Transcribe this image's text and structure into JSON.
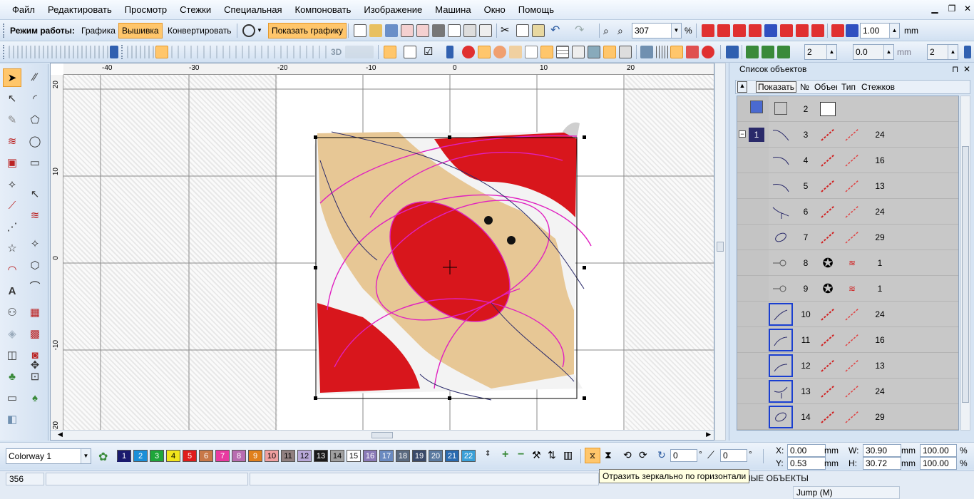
{
  "menu": [
    "Файл",
    "Редактировать",
    "Просмотр",
    "Стежки",
    "Специальная",
    "Компоновать",
    "Изображение",
    "Машина",
    "Окно",
    "Помощь"
  ],
  "toolbar1": {
    "mode_label": "Режим работы:",
    "mode_graphics": "Графика",
    "mode_embroidery": "Вышивка",
    "mode_convert": "Конвертировать",
    "show_graphics": "Показать графику",
    "zoom_value": "307",
    "zoom_unit": "%",
    "width_value": "1.00",
    "width_unit": "mm"
  },
  "toolbar2": {
    "label_3d": "3D",
    "field_a": "2",
    "field_b": "0.0",
    "field_b_unit": "mm",
    "field_c": "2"
  },
  "ruler": {
    "top_ticks": [
      "-40",
      "-30",
      "-20",
      "-10",
      "0",
      "10",
      "20"
    ],
    "left_ticks": [
      "20",
      "10",
      "0",
      "-10",
      "-20"
    ]
  },
  "object_panel": {
    "title": "Список объектов",
    "pin": "⊓",
    "close": "✕",
    "show_button": "Показать",
    "col_no": "№",
    "col_object": "Объект",
    "col_type": "Тип",
    "col_stitches": "Стежков",
    "group_number": "1",
    "rows": [
      {
        "no": "2",
        "stitches": ""
      },
      {
        "no": "3",
        "stitches": "24"
      },
      {
        "no": "4",
        "stitches": "16"
      },
      {
        "no": "5",
        "stitches": "13"
      },
      {
        "no": "6",
        "stitches": "24"
      },
      {
        "no": "7",
        "stitches": "29"
      },
      {
        "no": "8",
        "stitches": "1"
      },
      {
        "no": "9",
        "stitches": "1"
      },
      {
        "no": "10",
        "stitches": "24"
      },
      {
        "no": "11",
        "stitches": "16"
      },
      {
        "no": "12",
        "stitches": "13"
      },
      {
        "no": "13",
        "stitches": "24"
      },
      {
        "no": "14",
        "stitches": "29"
      }
    ]
  },
  "colorbar": {
    "colorway": "Colorway 1",
    "swatches": [
      {
        "n": "1",
        "color": "#1a1a6e",
        "fg": "#ffffff"
      },
      {
        "n": "2",
        "color": "#1a8fd8",
        "fg": "#ffffff"
      },
      {
        "n": "3",
        "color": "#1ea63a",
        "fg": "#ffffff"
      },
      {
        "n": "4",
        "color": "#f2e41c",
        "fg": "#000000"
      },
      {
        "n": "5",
        "color": "#e01c1c",
        "fg": "#ffffff"
      },
      {
        "n": "6",
        "color": "#c87848",
        "fg": "#ffffff"
      },
      {
        "n": "7",
        "color": "#e83aa0",
        "fg": "#ffffff"
      },
      {
        "n": "8",
        "color": "#b86cb0",
        "fg": "#ffffff"
      },
      {
        "n": "9",
        "color": "#e0801c",
        "fg": "#ffffff"
      },
      {
        "n": "10",
        "color": "#f0a0a0",
        "fg": "#000000"
      },
      {
        "n": "11",
        "color": "#908080",
        "fg": "#000000"
      },
      {
        "n": "12",
        "color": "#b8a8d8",
        "fg": "#000000"
      },
      {
        "n": "13",
        "color": "#1a1a1a",
        "fg": "#ffffff"
      },
      {
        "n": "14",
        "color": "#a0a0a0",
        "fg": "#000000"
      },
      {
        "n": "15",
        "color": "#ffffff",
        "fg": "#000000"
      },
      {
        "n": "16",
        "color": "#8a7ab8",
        "fg": "#ffffff"
      },
      {
        "n": "17",
        "color": "#6a8ac0",
        "fg": "#ffffff"
      },
      {
        "n": "18",
        "color": "#5a6a80",
        "fg": "#ffffff"
      },
      {
        "n": "19",
        "color": "#3a4a6a",
        "fg": "#ffffff"
      },
      {
        "n": "20",
        "color": "#5a7aa0",
        "fg": "#ffffff"
      },
      {
        "n": "21",
        "color": "#2a6ab0",
        "fg": "#ffffff"
      },
      {
        "n": "22",
        "color": "#3aa0d8",
        "fg": "#ffffff"
      }
    ],
    "rotate_value": "0",
    "rotate_unit": "°",
    "slant_value": "0",
    "slant_unit": "°"
  },
  "geometry": {
    "x_label": "X:",
    "x_value": "0.00",
    "x_unit": "mm",
    "y_label": "Y:",
    "y_value": "0.53",
    "y_unit": "mm",
    "w_label": "W:",
    "w_value": "30.90",
    "w_unit": "mm",
    "w_pct": "100.00",
    "w_pct_unit": "%",
    "h_label": "H:",
    "h_value": "30.72",
    "h_unit": "mm",
    "h_pct": "100.00",
    "h_pct_unit": "%"
  },
  "status": {
    "count": "356",
    "selection": "НЫЕ ОБЪЕКТЫ",
    "stitch_type": "Jump (M)"
  },
  "tooltip": "Отразить зеркально по горизонтали"
}
